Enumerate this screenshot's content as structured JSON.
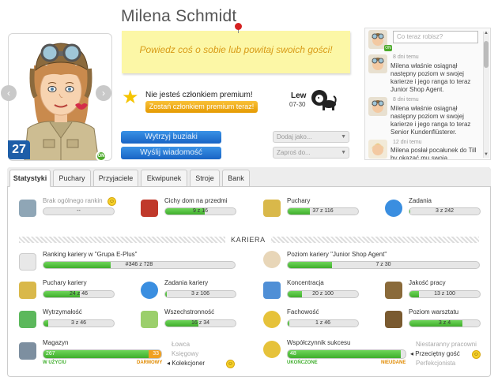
{
  "profile": {
    "name": "Milena Schmidt",
    "level": "27",
    "online_badge": "ON",
    "sticky_note": "Powiedz coś o sobie lub powitaj swoich gości!",
    "premium_text": "Nie jesteś członkiem premium!",
    "premium_button": "Zostań członkiem premium teraz!",
    "zodiac_name": "Lew",
    "zodiac_dates": "07-30",
    "send_kisses": "Wytrzyj buziaki",
    "send_message": "Wyślij wiadomość",
    "add_as": "Dodaj jako...",
    "invite_to": "Zaproś do...",
    "prev_arrow": "‹",
    "next_arrow": "›"
  },
  "feed": {
    "placeholder": "Co teraz robisz?",
    "items": [
      {
        "time": "8 dni temu",
        "text": "Milena właśnie osiągnął następny poziom w swojej karierze i jego ranga to teraz Junior Shop Agent."
      },
      {
        "time": "8 dni temu",
        "text": "Milena właśnie osiągnął następny poziom w swojej karierze i jego ranga to teraz Senior Kundenflüsterer."
      },
      {
        "time": "12 dni temu",
        "text": "Milena posłał pocałunek do Till by okazać mu swoją"
      }
    ]
  },
  "tabs": [
    "Statystyki",
    "Puchary",
    "Przyjaciele",
    "Ekwipunek",
    "Stroje",
    "Bank"
  ],
  "stats_top": [
    {
      "label": "Brak ogólnego rankin",
      "value": "--",
      "fill": 0
    },
    {
      "label": "Cichy dom na przedmi",
      "value": "9 z 16",
      "fill": 0.5625
    },
    {
      "label": "Puchary",
      "value": "37 z 116",
      "fill": 0.319
    },
    {
      "label": "Zadania",
      "value": "3 z 242",
      "fill": 0.012
    }
  ],
  "section_title": "KARIERA",
  "career_rows": [
    {
      "label": "Ranking kariery w \"Grupa E-Plus\"",
      "value": "#346 z 728",
      "fill": 0.35
    },
    {
      "label": "Poziom kariery \"Junior Shop Agent\"",
      "value": "7 z 30",
      "fill": 0.233
    }
  ],
  "stats_grid": [
    {
      "label": "Puchary kariery",
      "value": "24 z 46",
      "fill": 0.52
    },
    {
      "label": "Zadania kariery",
      "value": "3 z 106",
      "fill": 0.028
    },
    {
      "label": "Koncentracja",
      "value": "20 z 100",
      "fill": 0.2
    },
    {
      "label": "Jakość pracy",
      "value": "13 z 100",
      "fill": 0.13
    },
    {
      "label": "Wytrzymałość",
      "value": "3 z 46",
      "fill": 0.065
    },
    {
      "label": "Wszechstronność",
      "value": "16 z 34",
      "fill": 0.47
    },
    {
      "label": "Fachowość",
      "value": "1 z 46",
      "fill": 0.022
    },
    {
      "label": "Poziom warsztatu",
      "value": "3 z 4",
      "fill": 0.75
    }
  ],
  "magazyn": {
    "label": "Magazyn",
    "used": "267",
    "free": "33",
    "used_tag": "W UŻYCIU",
    "free_tag": "DARMOWY",
    "fill": 0.89,
    "options": [
      "Łowca",
      "Księgowy",
      "Kolekcjoner"
    ]
  },
  "sukces": {
    "label": "Współczynnik sukcesu",
    "value": "48",
    "done_tag": "UKOŃCZONE",
    "failed_tag": "NIEUDANE",
    "fill": 0.96,
    "options": [
      "Niestaranny pracowni",
      "Przeciętny gość",
      "Perfekcjonista"
    ]
  }
}
